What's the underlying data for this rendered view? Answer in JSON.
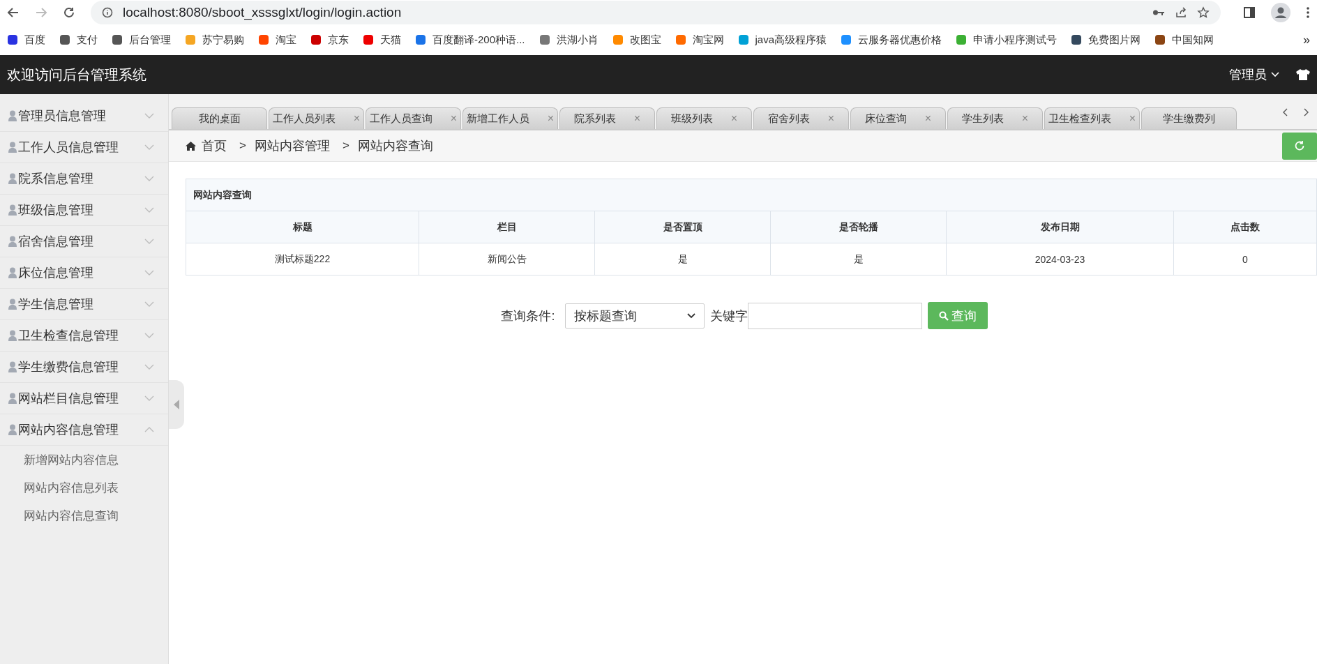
{
  "browser": {
    "url": "localhost:8080/sboot_xsssglxt/login/login.action",
    "bookmarks": [
      {
        "label": "百度"
      },
      {
        "label": "支付"
      },
      {
        "label": "后台管理"
      },
      {
        "label": "苏宁易购"
      },
      {
        "label": "淘宝"
      },
      {
        "label": "京东"
      },
      {
        "label": "天猫"
      },
      {
        "label": "百度翻译-200种语..."
      },
      {
        "label": "洪湖小肖"
      },
      {
        "label": "改图宝"
      },
      {
        "label": "淘宝网"
      },
      {
        "label": "java高级程序猿"
      },
      {
        "label": "云服务器优惠价格"
      },
      {
        "label": "申请小程序测试号"
      },
      {
        "label": "免费图片网"
      },
      {
        "label": "中国知网"
      }
    ],
    "more": "»"
  },
  "header": {
    "title": "欢迎访问后台管理系统",
    "user": "管理员"
  },
  "sidebar": {
    "items": [
      {
        "label": "管理员信息管理",
        "expanded": false
      },
      {
        "label": "工作人员信息管理",
        "expanded": false
      },
      {
        "label": "院系信息管理",
        "expanded": false
      },
      {
        "label": "班级信息管理",
        "expanded": false
      },
      {
        "label": "宿舍信息管理",
        "expanded": false
      },
      {
        "label": "床位信息管理",
        "expanded": false
      },
      {
        "label": "学生信息管理",
        "expanded": false
      },
      {
        "label": "卫生检查信息管理",
        "expanded": false
      },
      {
        "label": "学生缴费信息管理",
        "expanded": false
      },
      {
        "label": "网站栏目信息管理",
        "expanded": false
      },
      {
        "label": "网站内容信息管理",
        "expanded": true,
        "children": [
          {
            "label": "新增网站内容信息"
          },
          {
            "label": "网站内容信息列表"
          },
          {
            "label": "网站内容信息查询"
          }
        ]
      }
    ]
  },
  "tabs": [
    {
      "label": "我的桌面",
      "selected": false
    },
    {
      "label": "工作人员列表",
      "close": "×",
      "selected": false
    },
    {
      "label": "工作人员查询",
      "close": "×",
      "selected": false
    },
    {
      "label": "新增工作人员",
      "close": "×",
      "selected": false
    },
    {
      "label": "院系列表",
      "close": "×",
      "selected": false
    },
    {
      "label": "班级列表",
      "close": "×",
      "selected": false
    },
    {
      "label": "宿舍列表",
      "close": "×",
      "selected": false
    },
    {
      "label": "床位查询",
      "close": "×",
      "selected": false
    },
    {
      "label": "学生列表",
      "close": "×",
      "selected": false
    },
    {
      "label": "卫生检查列表",
      "close": "×",
      "selected": false
    },
    {
      "label": "学生缴费列",
      "selected": false
    }
  ],
  "breadcrumb": [
    "首页",
    "网站内容管理",
    "网站内容查询"
  ],
  "breadcrumb_separator": ">",
  "table": {
    "title": "网站内容查询",
    "columns": [
      "标题",
      "栏目",
      "是否置顶",
      "是否轮播",
      "发布日期",
      "点击数"
    ],
    "rows": [
      [
        "测试标题222",
        "新闻公告",
        "是",
        "是",
        "2024-03-23",
        "0"
      ]
    ]
  },
  "search": {
    "label": "查询条件:",
    "select_value": "按标题查询",
    "keyword_label": "关键字",
    "button": "查询"
  }
}
